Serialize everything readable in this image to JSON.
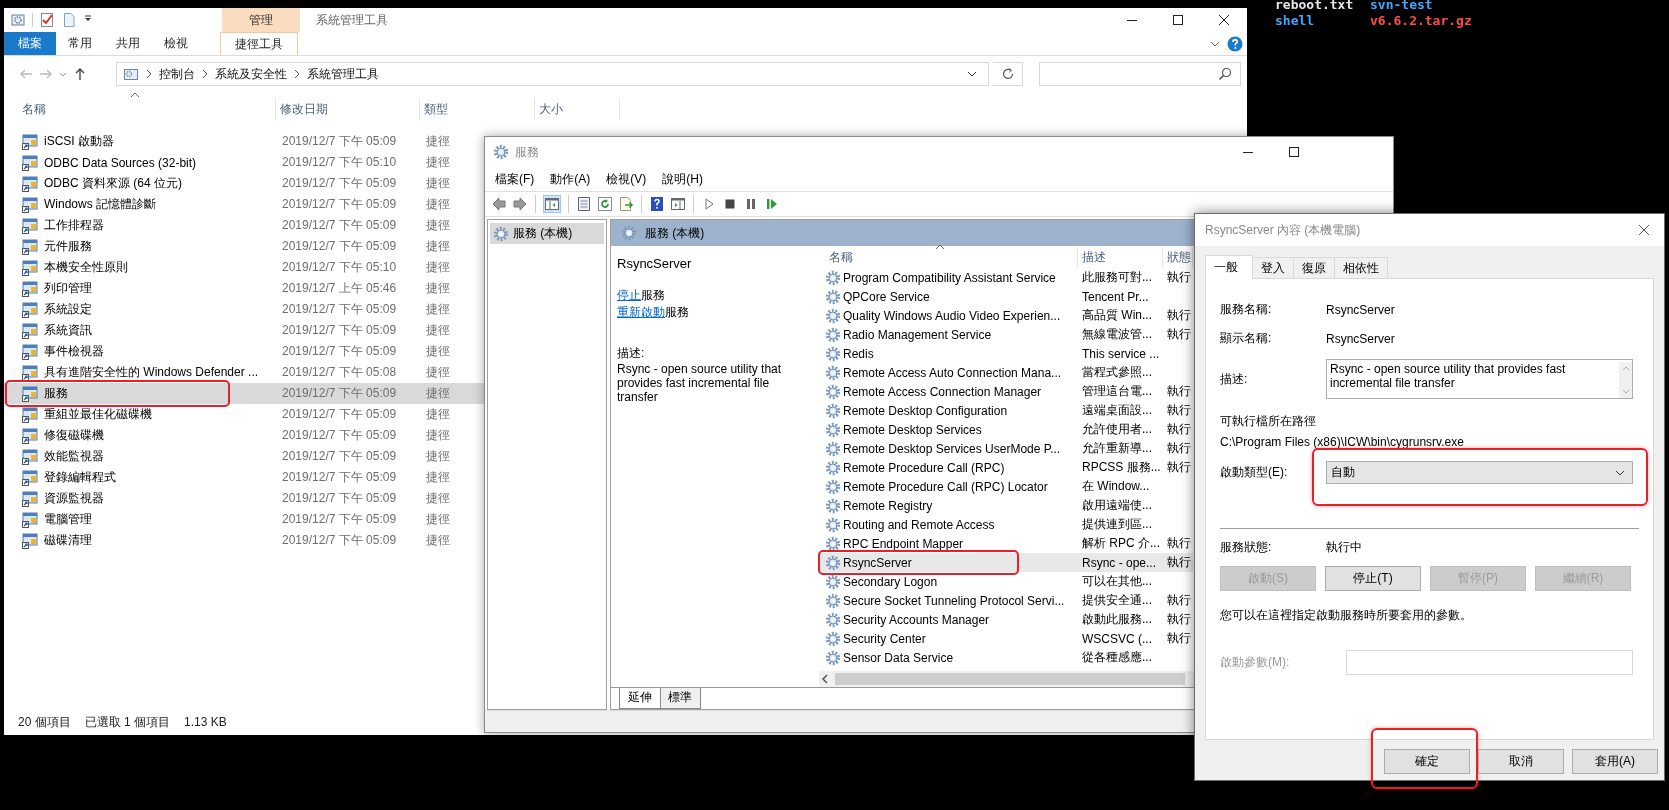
{
  "terminal": {
    "lines": [
      {
        "cells": [
          {
            "text": "reboot.txt",
            "color": "#e6e6e6"
          },
          {
            "text": "svn-test",
            "color": "#3fa8ff"
          }
        ]
      },
      {
        "cells": [
          {
            "text": "shell",
            "color": "#3fa8ff"
          },
          {
            "text": "v6.6.2.tar.gz",
            "color": "#ff4d4d"
          }
        ]
      }
    ]
  },
  "explorer": {
    "title": "系統管理工具",
    "context_group": "管理",
    "ribbon_tabs": [
      {
        "label": "檔案",
        "kind": "file"
      },
      {
        "label": "常用",
        "kind": "tab"
      },
      {
        "label": "共用",
        "kind": "tab"
      },
      {
        "label": "檢視",
        "kind": "tab"
      },
      {
        "label": "捷徑工具",
        "kind": "context"
      }
    ],
    "breadcrumb": [
      "控制台",
      "系統及安全性",
      "系統管理工具"
    ],
    "columns": [
      "名稱",
      "修改日期",
      "類型",
      "大小"
    ],
    "rows": [
      {
        "name": "iSCSI 啟動器",
        "modified": "2019/12/7 下午 05:09",
        "type": "捷徑",
        "selected": false,
        "highlighted": false
      },
      {
        "name": "ODBC Data Sources (32-bit)",
        "modified": "2019/12/7 下午 05:10",
        "type": "捷徑",
        "selected": false,
        "highlighted": false
      },
      {
        "name": "ODBC 資料來源 (64 位元)",
        "modified": "2019/12/7 下午 05:09",
        "type": "捷徑",
        "selected": false,
        "highlighted": false
      },
      {
        "name": "Windows 記憶體診斷",
        "modified": "2019/12/7 下午 05:09",
        "type": "捷徑",
        "selected": false,
        "highlighted": false
      },
      {
        "name": "工作排程器",
        "modified": "2019/12/7 下午 05:09",
        "type": "捷徑",
        "selected": false,
        "highlighted": false
      },
      {
        "name": "元件服務",
        "modified": "2019/12/7 下午 05:09",
        "type": "捷徑",
        "selected": false,
        "highlighted": false
      },
      {
        "name": "本機安全性原則",
        "modified": "2019/12/7 下午 05:10",
        "type": "捷徑",
        "selected": false,
        "highlighted": false
      },
      {
        "name": "列印管理",
        "modified": "2019/12/7 上午 05:46",
        "type": "捷徑",
        "selected": false,
        "highlighted": false
      },
      {
        "name": "系統設定",
        "modified": "2019/12/7 下午 05:09",
        "type": "捷徑",
        "selected": false,
        "highlighted": false
      },
      {
        "name": "系統資訊",
        "modified": "2019/12/7 下午 05:09",
        "type": "捷徑",
        "selected": false,
        "highlighted": false
      },
      {
        "name": "事件檢視器",
        "modified": "2019/12/7 下午 05:09",
        "type": "捷徑",
        "selected": false,
        "highlighted": false
      },
      {
        "name": "具有進階安全性的 Windows Defender ...",
        "modified": "2019/12/7 下午 05:08",
        "type": "捷徑",
        "selected": false,
        "highlighted": false
      },
      {
        "name": "服務",
        "modified": "2019/12/7 下午 05:09",
        "type": "捷徑",
        "selected": true,
        "highlighted": true
      },
      {
        "name": "重組並最佳化磁碟機",
        "modified": "2019/12/7 下午 05:09",
        "type": "捷徑",
        "selected": false,
        "highlighted": false
      },
      {
        "name": "修復磁碟機",
        "modified": "2019/12/7 下午 05:09",
        "type": "捷徑",
        "selected": false,
        "highlighted": false
      },
      {
        "name": "效能監視器",
        "modified": "2019/12/7 下午 05:09",
        "type": "捷徑",
        "selected": false,
        "highlighted": false
      },
      {
        "name": "登錄編輯程式",
        "modified": "2019/12/7 下午 05:09",
        "type": "捷徑",
        "selected": false,
        "highlighted": false
      },
      {
        "name": "資源監視器",
        "modified": "2019/12/7 下午 05:09",
        "type": "捷徑",
        "selected": false,
        "highlighted": false
      },
      {
        "name": "電腦管理",
        "modified": "2019/12/7 下午 05:09",
        "type": "捷徑",
        "selected": false,
        "highlighted": false
      },
      {
        "name": "磁碟清理",
        "modified": "2019/12/7 下午 05:09",
        "type": "捷徑",
        "selected": false,
        "highlighted": false
      }
    ],
    "status_bar": {
      "count": "20 個項目",
      "selection": "已選取 1 個項目",
      "size": "1.13 KB"
    }
  },
  "services": {
    "title": "服務",
    "menu": [
      "檔案(F)",
      "動作(A)",
      "檢視(V)",
      "說明(H)"
    ],
    "tree": [
      {
        "label": "服務 (本機)",
        "selected": true
      }
    ],
    "pane_header": "服務 (本機)",
    "detail": {
      "name": "RsyncServer",
      "actions": [
        {
          "link": "停止",
          "rest": "服務"
        },
        {
          "link": "重新啟動",
          "rest": "服務"
        }
      ],
      "description_label": "描述:",
      "description": "Rsync - open source utility that provides fast incremental file transfer"
    },
    "columns": [
      "名稱",
      "描述",
      "狀態"
    ],
    "rows": [
      {
        "name": "Program Compatibility Assistant Service",
        "description": "此服務可對...",
        "status": "執行",
        "selected": false,
        "highlighted": false
      },
      {
        "name": "QPCore Service",
        "description": "Tencent Pr...",
        "selected": false,
        "highlighted": false
      },
      {
        "name": "Quality Windows Audio Video Experien...",
        "description": "高品質 Win...",
        "status": "執行",
        "selected": false,
        "highlighted": false
      },
      {
        "name": "Radio Management Service",
        "description": "無線電波管...",
        "status": "執行",
        "selected": false,
        "highlighted": false
      },
      {
        "name": "Redis",
        "description": "This service ...",
        "selected": false,
        "highlighted": false
      },
      {
        "name": "Remote Access Auto Connection Mana...",
        "description": "當程式參照...",
        "selected": false,
        "highlighted": false
      },
      {
        "name": "Remote Access Connection Manager",
        "description": "管理這台電...",
        "status": "執行",
        "selected": false,
        "highlighted": false
      },
      {
        "name": "Remote Desktop Configuration",
        "description": "遠端桌面設...",
        "status": "執行",
        "selected": false,
        "highlighted": false
      },
      {
        "name": "Remote Desktop Services",
        "description": "允許使用者...",
        "status": "執行",
        "selected": false,
        "highlighted": false
      },
      {
        "name": "Remote Desktop Services UserMode P...",
        "description": "允許重新導...",
        "status": "執行",
        "selected": false,
        "highlighted": false
      },
      {
        "name": "Remote Procedure Call (RPC)",
        "description": "RPCSS 服務...",
        "status": "執行",
        "selected": false,
        "highlighted": false
      },
      {
        "name": "Remote Procedure Call (RPC) Locator",
        "description": "在 Window...",
        "selected": false,
        "highlighted": false
      },
      {
        "name": "Remote Registry",
        "description": "啟用遠端使...",
        "selected": false,
        "highlighted": false
      },
      {
        "name": "Routing and Remote Access",
        "description": "提供連到區...",
        "selected": false,
        "highlighted": false
      },
      {
        "name": "RPC Endpoint Mapper",
        "description": "解析 RPC 介...",
        "status": "執行",
        "selected": false,
        "highlighted": false
      },
      {
        "name": "RsyncServer",
        "description": "Rsync - ope...",
        "status": "執行",
        "selected": true,
        "highlighted": true
      },
      {
        "name": "Secondary Logon",
        "description": "可以在其他...",
        "selected": false,
        "highlighted": false
      },
      {
        "name": "Secure Socket Tunneling Protocol Servi...",
        "description": "提供安全通...",
        "status": "執行",
        "selected": false,
        "highlighted": false
      },
      {
        "name": "Security Accounts Manager",
        "description": "啟動此服務...",
        "status": "執行",
        "selected": false,
        "highlighted": false
      },
      {
        "name": "Security Center",
        "description": "WSCSVC (...",
        "status": "執行",
        "selected": false,
        "highlighted": false
      },
      {
        "name": "Sensor Data Service",
        "description": "從各種感應...",
        "selected": false,
        "highlighted": false
      }
    ],
    "view_tabs": [
      {
        "label": "延伸",
        "selected": true
      },
      {
        "label": "標準",
        "selected": false
      }
    ]
  },
  "dialog": {
    "title": "RsyncServer 內容 (本機電腦)",
    "tabs": [
      {
        "label": "一般",
        "selected": true
      },
      {
        "label": "登入",
        "selected": false
      },
      {
        "label": "復原",
        "selected": false
      },
      {
        "label": "相依性",
        "selected": false
      }
    ],
    "fields": [
      {
        "label": "服務名稱:",
        "value": "RsyncServer"
      },
      {
        "label": "顯示名稱:",
        "value": "RsyncServer"
      }
    ],
    "description": {
      "label": "描述:",
      "value": "Rsync - open source utility that provides fast incremental file transfer"
    },
    "path": {
      "label": "可執行檔所在路徑",
      "value": "C:\\Program Files (x86)\\ICW\\bin\\cygrunsrv.exe"
    },
    "startup_type": {
      "label": "啟動類型(E):",
      "value": "自動",
      "highlighted": true
    },
    "service_status": {
      "label": "服務狀態:",
      "value": "執行中"
    },
    "control_buttons": [
      {
        "label": "啟動(S)",
        "disabled": true
      },
      {
        "label": "停止(T)",
        "disabled": false
      },
      {
        "label": "暫停(P)",
        "disabled": true
      },
      {
        "label": "繼續(R)",
        "disabled": true
      }
    ],
    "note": "您可以在這裡指定啟動服務時所要套用的參數。",
    "start_parameters": {
      "label": "啟動參數(M):",
      "disabled": true
    },
    "buttons": [
      {
        "label": "確定",
        "highlighted": true
      },
      {
        "label": "取消",
        "highlighted": false
      },
      {
        "label": "套用(A)",
        "highlighted": false
      }
    ]
  }
}
